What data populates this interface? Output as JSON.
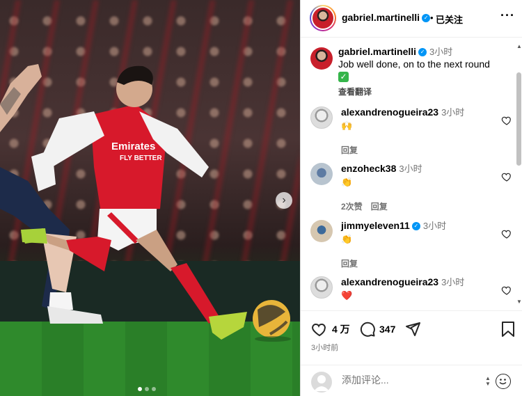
{
  "post": {
    "username": "gabriel.martinelli",
    "verified": true,
    "follow_label": "已关注",
    "follow_separator": "•",
    "more_label": "···"
  },
  "caption": {
    "username": "gabriel.martinelli",
    "time": "3小时",
    "text": "Job well done, on to the next round",
    "emoji": "✅",
    "see_translation": "查看翻译"
  },
  "comments": [
    {
      "username": "alexandrenogueira23",
      "verified": false,
      "time": "3小时",
      "emoji": "🙌",
      "likes": "",
      "reply": "回复"
    },
    {
      "username": "enzoheck38",
      "verified": false,
      "time": "3小时",
      "emoji": "👏",
      "likes": "2次赞",
      "reply": "回复"
    },
    {
      "username": "jimmyeleven11",
      "verified": true,
      "time": "3小时",
      "emoji": "👏",
      "likes": "",
      "reply": "回复"
    },
    {
      "username": "alexandrenogueira23",
      "verified": false,
      "time": "3小时",
      "emoji": "❤️",
      "likes": "",
      "reply": ""
    }
  ],
  "actions": {
    "like_count": "4 万",
    "comment_count": "347",
    "posted_time": "3小时前"
  },
  "comment_input": {
    "placeholder": "添加评论..."
  },
  "carousel": {
    "next_label": "›",
    "slide_count": 3,
    "active_slide": 1
  },
  "colors": {
    "verified_blue": "#0095f6",
    "secondary_text": "#737373",
    "border": "#efefef",
    "arsenal_red": "#d7192b"
  }
}
